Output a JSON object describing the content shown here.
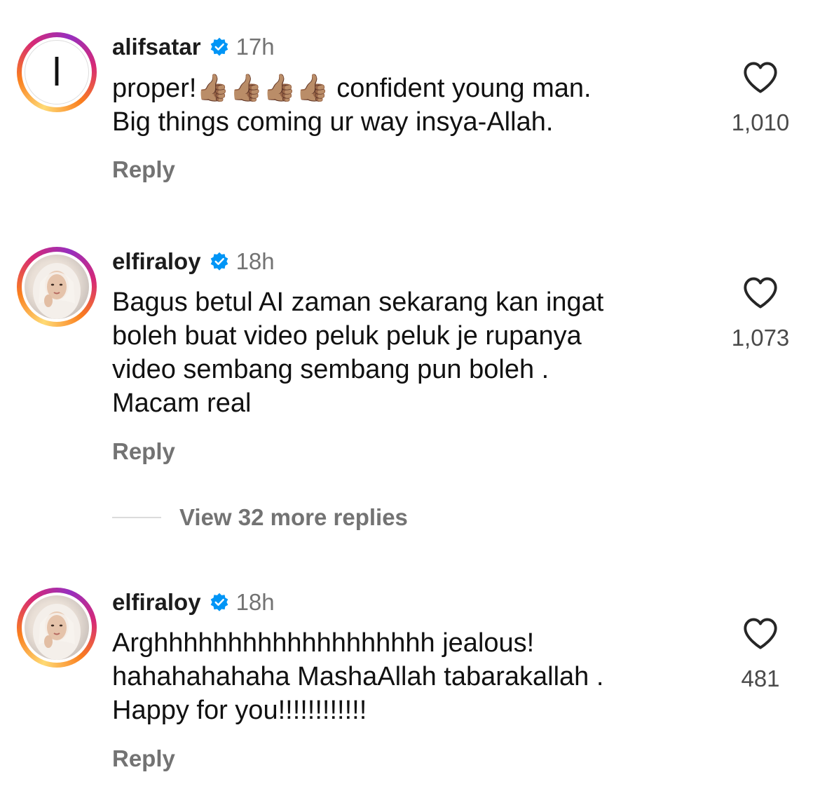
{
  "comments": [
    {
      "username": "alifsatar",
      "time": "17h",
      "text": "proper!👍🏽👍🏽👍🏽👍🏽 confident young man.\nBig things coming ur way insya-Allah.",
      "reply_label": "Reply",
      "likes": "1,010",
      "avatar_letter": "ا"
    },
    {
      "username": "elfiraloy",
      "time": "18h",
      "text": "Bagus betul AI zaman sekarang kan ingat\nboleh buat video peluk peluk je rupanya\nvideo sembang sembang pun boleh .\nMacam real",
      "reply_label": "Reply",
      "likes": "1,073"
    },
    {
      "username": "elfiraloy",
      "time": "18h",
      "text": "Arghhhhhhhhhhhhhhhhhhh jealous!\nhahahahahaha MashaAllah tabarakallah .\nHappy for you!!!!!!!!!!!!",
      "reply_label": "Reply",
      "likes": "481"
    }
  ],
  "view_more_replies": "View 32 more replies",
  "colors": {
    "verified": "#0095f6",
    "secondary_text": "#737373"
  },
  "icons": {
    "verified": "verified-badge-icon",
    "like": "heart-outline-icon"
  }
}
